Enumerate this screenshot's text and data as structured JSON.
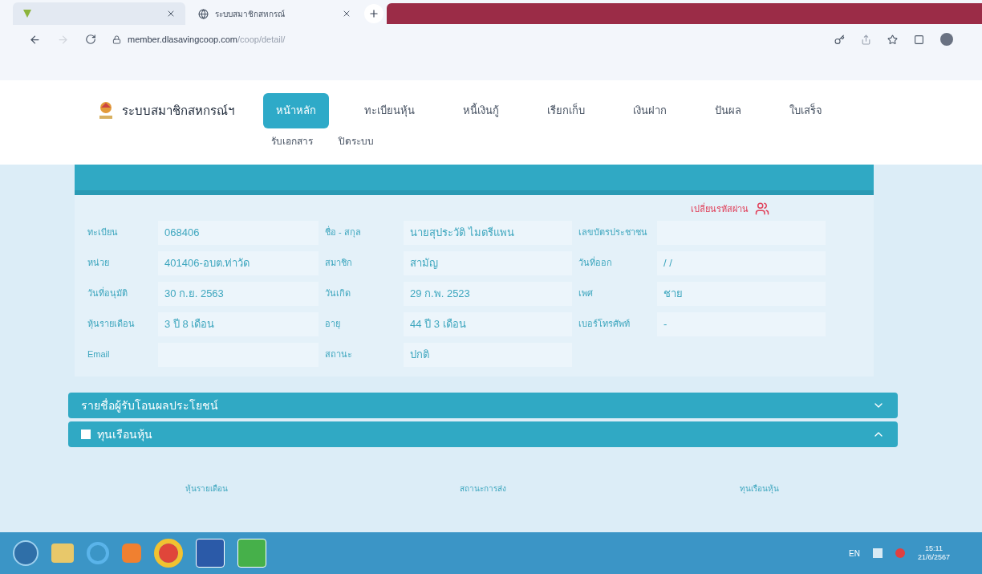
{
  "browser": {
    "tabs": [
      {
        "selected": true
      },
      {
        "title": "ระบบสมาชิกสหกรณ์",
        "selected": false
      }
    ],
    "url_host": "member.dlasavingcoop.com",
    "url_path": "/coop/detail/"
  },
  "site": {
    "logo_text": "ระบบสมาชิกสหกรณ์ฯ",
    "nav": [
      {
        "label": "หน้าหลัก",
        "selected": true
      },
      {
        "label": "ทะเบียนหุ้น",
        "selected": false
      },
      {
        "label": "หนี้เงินกู้",
        "selected": false
      },
      {
        "label": "เรียกเก็บ",
        "selected": false
      },
      {
        "label": "เงินฝาก",
        "selected": false
      },
      {
        "label": "ปันผล",
        "selected": false
      },
      {
        "label": "ใบเสร็จ",
        "selected": false
      }
    ],
    "nav_row2": [
      {
        "label": "รับเอกสาร",
        "selected": false
      },
      {
        "label": "ปิดระบบ",
        "selected": false
      }
    ]
  },
  "profile": {
    "change_password": "เปลี่ยนรหัสผ่าน",
    "fields": [
      {
        "label": "ทะเบียน",
        "value": "068406"
      },
      {
        "label": "ชื่อ - สกุล",
        "value": "นายสุประวัติ ไมตรีแพน"
      },
      {
        "label": "เลขบัตรประชาชน"
      },
      {
        "label": "หน่วย",
        "value": "401406-อบต.ท่าวัด"
      },
      {
        "label": "สมาชิก",
        "value": "สามัญ"
      },
      {
        "label": "วันที่ออก",
        "value": "/ /"
      },
      {
        "label": "วันที่อนุมัติ",
        "value": "30 ก.ย. 2563"
      },
      {
        "label": "วันเกิด",
        "value": "29 ก.พ. 2523"
      },
      {
        "label": "เพศ",
        "value": "ชาย"
      },
      {
        "label": "หุ้นรายเดือน",
        "value": "3 ปี 8 เดือน"
      },
      {
        "label": "อายุ",
        "value": "44 ปี 3 เดือน"
      },
      {
        "label": "เบอร์โทรศัพท์",
        "value": "-"
      },
      {
        "label": "Email"
      },
      {
        "label": "สถานะ",
        "value": "ปกติ"
      }
    ]
  },
  "sections": [
    {
      "title": "รายชื่อผู้รับโอนผลประโยชน์",
      "expanded": false
    },
    {
      "title": "ทุนเรือนหุ้น",
      "expanded": true,
      "columns": [
        "หุ้นรายเดือน",
        "สถานะการส่ง",
        "ทุนเรือนหุ้น"
      ]
    }
  ],
  "taskbar": {
    "language": "EN",
    "time": "15:11",
    "date": "21/6/2567"
  }
}
